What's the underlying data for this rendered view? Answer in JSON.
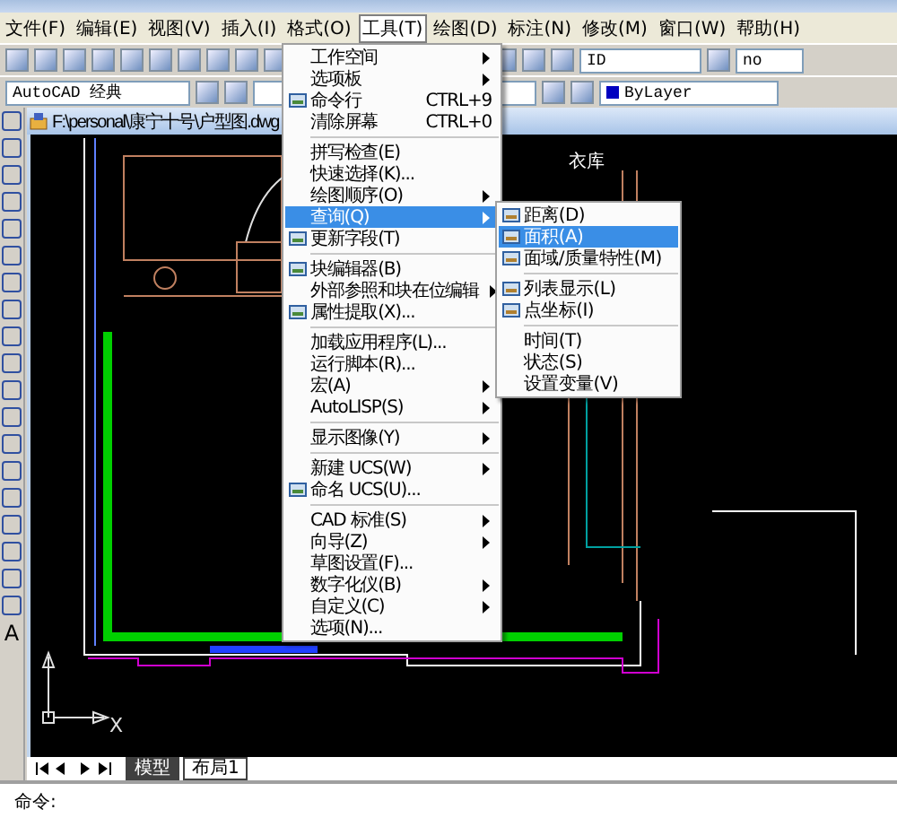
{
  "menubar": [
    {
      "label": "文件(F)",
      "selected": false
    },
    {
      "label": "编辑(E)",
      "selected": false
    },
    {
      "label": "视图(V)",
      "selected": false
    },
    {
      "label": "插入(I)",
      "selected": false
    },
    {
      "label": "格式(O)",
      "selected": false
    },
    {
      "label": "工具(T)",
      "selected": true
    },
    {
      "label": "绘图(D)",
      "selected": false
    },
    {
      "label": "标注(N)",
      "selected": false
    },
    {
      "label": "修改(M)",
      "selected": false
    },
    {
      "label": "窗口(W)",
      "selected": false
    },
    {
      "label": "帮助(H)",
      "selected": false
    }
  ],
  "toolbar": {
    "text_style": "ID",
    "dim_style": "no",
    "workspace": "AutoCAD 经典",
    "color_setting": "ByLayer"
  },
  "left_tools": {
    "text_tool": "A"
  },
  "document": {
    "title": "F:\\personal\\康宁十号\\户型图.dwg",
    "room_label": "衣库",
    "axis_label": "X",
    "tabs": [
      {
        "label": "模型",
        "selected": true
      },
      {
        "label": "布局1",
        "selected": false
      }
    ]
  },
  "tools_menu": [
    {
      "kind": "item",
      "label": "工作空间",
      "submenu": true,
      "selected": false
    },
    {
      "kind": "item",
      "label": "选项板",
      "submenu": true,
      "selected": false
    },
    {
      "kind": "icon_item",
      "label": "命令行",
      "shortcut": "CTRL+9",
      "selected": false
    },
    {
      "kind": "item",
      "label": "清除屏幕",
      "shortcut": "CTRL+0",
      "selected": false
    },
    {
      "kind": "separator"
    },
    {
      "kind": "item",
      "label": "拼写检查(E)",
      "selected": false
    },
    {
      "kind": "item",
      "label": "快速选择(K)...",
      "selected": false
    },
    {
      "kind": "item",
      "label": "绘图顺序(O)",
      "submenu": true,
      "selected": false
    },
    {
      "kind": "item",
      "label": "查询(Q)",
      "submenu": true,
      "selected": true
    },
    {
      "kind": "icon_item",
      "label": "更新字段(T)",
      "selected": false
    },
    {
      "kind": "separator"
    },
    {
      "kind": "icon_item",
      "label": "块编辑器(B)",
      "selected": false
    },
    {
      "kind": "item",
      "label": "外部参照和块在位编辑",
      "submenu": true,
      "selected": false
    },
    {
      "kind": "icon_item",
      "label": "属性提取(X)...",
      "selected": false
    },
    {
      "kind": "separator"
    },
    {
      "kind": "item",
      "label": "加载应用程序(L)...",
      "selected": false
    },
    {
      "kind": "item",
      "label": "运行脚本(R)...",
      "selected": false
    },
    {
      "kind": "item",
      "label": "宏(A)",
      "submenu": true,
      "selected": false
    },
    {
      "kind": "item",
      "label": "AutoLISP(S)",
      "submenu": true,
      "selected": false
    },
    {
      "kind": "separator"
    },
    {
      "kind": "item",
      "label": "显示图像(Y)",
      "submenu": true,
      "selected": false
    },
    {
      "kind": "separator"
    },
    {
      "kind": "item",
      "label": "新建 UCS(W)",
      "submenu": true,
      "selected": false
    },
    {
      "kind": "icon_item",
      "label": "命名 UCS(U)...",
      "selected": false
    },
    {
      "kind": "separator"
    },
    {
      "kind": "item",
      "label": "CAD 标准(S)",
      "submenu": true,
      "selected": false
    },
    {
      "kind": "item",
      "label": "向导(Z)",
      "submenu": true,
      "selected": false
    },
    {
      "kind": "item",
      "label": "草图设置(F)...",
      "selected": false
    },
    {
      "kind": "item",
      "label": "数字化仪(B)",
      "submenu": true,
      "selected": false
    },
    {
      "kind": "item",
      "label": "自定义(C)",
      "submenu": true,
      "selected": false
    },
    {
      "kind": "item",
      "label": "选项(N)...",
      "selected": false
    }
  ],
  "inquiry_submenu": [
    {
      "kind": "icon_item",
      "label": "距离(D)",
      "selected": false
    },
    {
      "kind": "icon_item",
      "label": "面积(A)",
      "selected": true
    },
    {
      "kind": "icon_item",
      "label": "面域/质量特性(M)",
      "selected": false
    },
    {
      "kind": "separator"
    },
    {
      "kind": "icon_item",
      "label": "列表显示(L)",
      "selected": false
    },
    {
      "kind": "icon_item",
      "label": "点坐标(I)",
      "selected": false
    },
    {
      "kind": "separator"
    },
    {
      "kind": "item",
      "label": "时间(T)",
      "selected": false
    },
    {
      "kind": "item",
      "label": "状态(S)",
      "selected": false
    },
    {
      "kind": "item",
      "label": "设置变量(V)",
      "selected": false
    }
  ],
  "command_line": {
    "prompt": "命令:"
  }
}
